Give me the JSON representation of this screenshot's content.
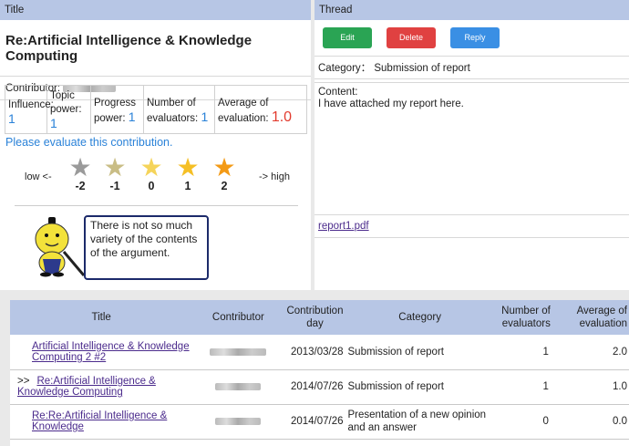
{
  "left_panel": {
    "header": "Title",
    "post_title": "Re:Artificial Intelligence & Knowledge Computing",
    "contributor_label": "Contributor:",
    "stats": [
      {
        "label": "Influence:",
        "value": "1"
      },
      {
        "label": "Topic power:",
        "value": "1"
      },
      {
        "label": "Progress power:",
        "value": "1"
      },
      {
        "label": "Number of evaluators:",
        "value": "1"
      },
      {
        "label": "Average of evaluation:",
        "value": "1.0"
      }
    ],
    "evaluate_prompt": "Please evaluate this contribution.",
    "low_label": "low <-",
    "high_label": "-> high",
    "stars": [
      {
        "score": "-2",
        "color": "#9a9a9a"
      },
      {
        "score": "-1",
        "color": "#c9bd85"
      },
      {
        "score": "0",
        "color": "#f5d45a"
      },
      {
        "score": "1",
        "color": "#f5bf25"
      },
      {
        "score": "2",
        "color": "#f39a16"
      }
    ],
    "bubble_text": "There is not so much variety of the contents of the argument."
  },
  "right_panel": {
    "header": "Thread",
    "buttons": {
      "edit": "Edit",
      "delete": "Delete",
      "reply": "Reply"
    },
    "category_line": "Category： Submission of report",
    "content_label": "Content:",
    "content_text": "I have attached my report here.",
    "attachment": "report1.pdf"
  },
  "table": {
    "headers": {
      "title": "Title",
      "contributor": "Contributor",
      "day": "Contribution day",
      "category": "Category",
      "evaluators": "Number of evaluators",
      "average": "Average of evaluation"
    },
    "rows": [
      {
        "marker": "",
        "title": "Artificial Intelligence & Knowledge Computing 2 #2",
        "day": "2013/03/28",
        "category": "Submission of report",
        "evaluators": "1",
        "average": "2.0"
      },
      {
        "marker": ">>",
        "title": "Re:Artificial Intelligence & Knowledge Computing",
        "day": "2014/07/26",
        "category": "Submission of report",
        "evaluators": "1",
        "average": "1.0"
      },
      {
        "marker": "",
        "title": "Re:Re:Artificial Intelligence & Knowledge",
        "day": "2014/07/26",
        "category": "Presentation of a new opinion and an answer",
        "evaluators": "0",
        "average": "0.0"
      }
    ]
  }
}
